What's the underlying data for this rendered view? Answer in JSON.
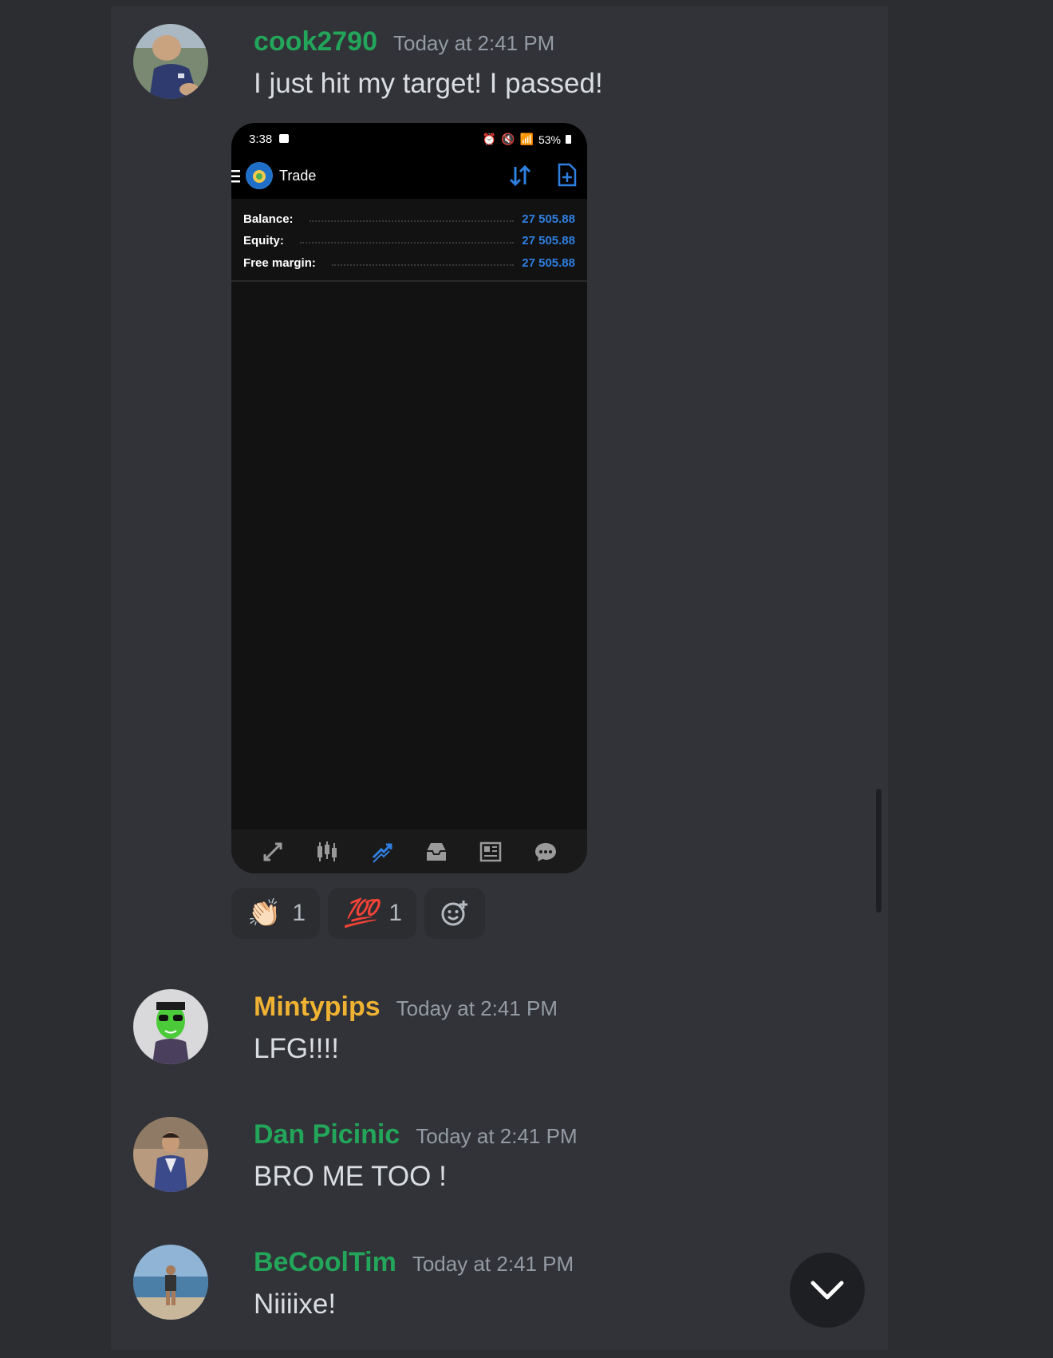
{
  "messages": [
    {
      "username": "cook2790",
      "username_color": "#23a55a",
      "timestamp": "Today at 2:41 PM",
      "text": "I just hit my target! I passed!"
    },
    {
      "username": "Mintypips",
      "username_color": "#f0b232",
      "timestamp": "Today at 2:41 PM",
      "text": "LFG!!!!"
    },
    {
      "username": "Dan Picinic",
      "username_color": "#23a55a",
      "timestamp": "Today at 2:41 PM",
      "text": "BRO ME TOO !"
    },
    {
      "username": "BeCoolTim",
      "username_color": "#23a55a",
      "timestamp": "Today at 2:41 PM",
      "text": "Niiiixe!"
    }
  ],
  "attachment": {
    "status_time": "3:38",
    "battery": "53%",
    "app_title": "Trade",
    "account_rows": [
      {
        "label": "Balance:",
        "value": "27 505.88"
      },
      {
        "label": "Equity:",
        "value": "27 505.88"
      },
      {
        "label": "Free margin:",
        "value": "27 505.88"
      }
    ],
    "nav_icons": [
      "quotes-icon",
      "chart-icon",
      "trade-icon",
      "history-icon",
      "news-icon",
      "messages-icon"
    ],
    "accent_color": "#2f7fe0"
  },
  "reactions": [
    {
      "emoji": "👏🏻",
      "icon": "clapping-hands-icon",
      "count": "1"
    },
    {
      "emoji": "💯",
      "icon": "hundred-points-icon",
      "count": "1"
    }
  ],
  "add_reaction_icon": "add-reaction-icon",
  "jump_to_present_icon": "chevron-down-icon"
}
